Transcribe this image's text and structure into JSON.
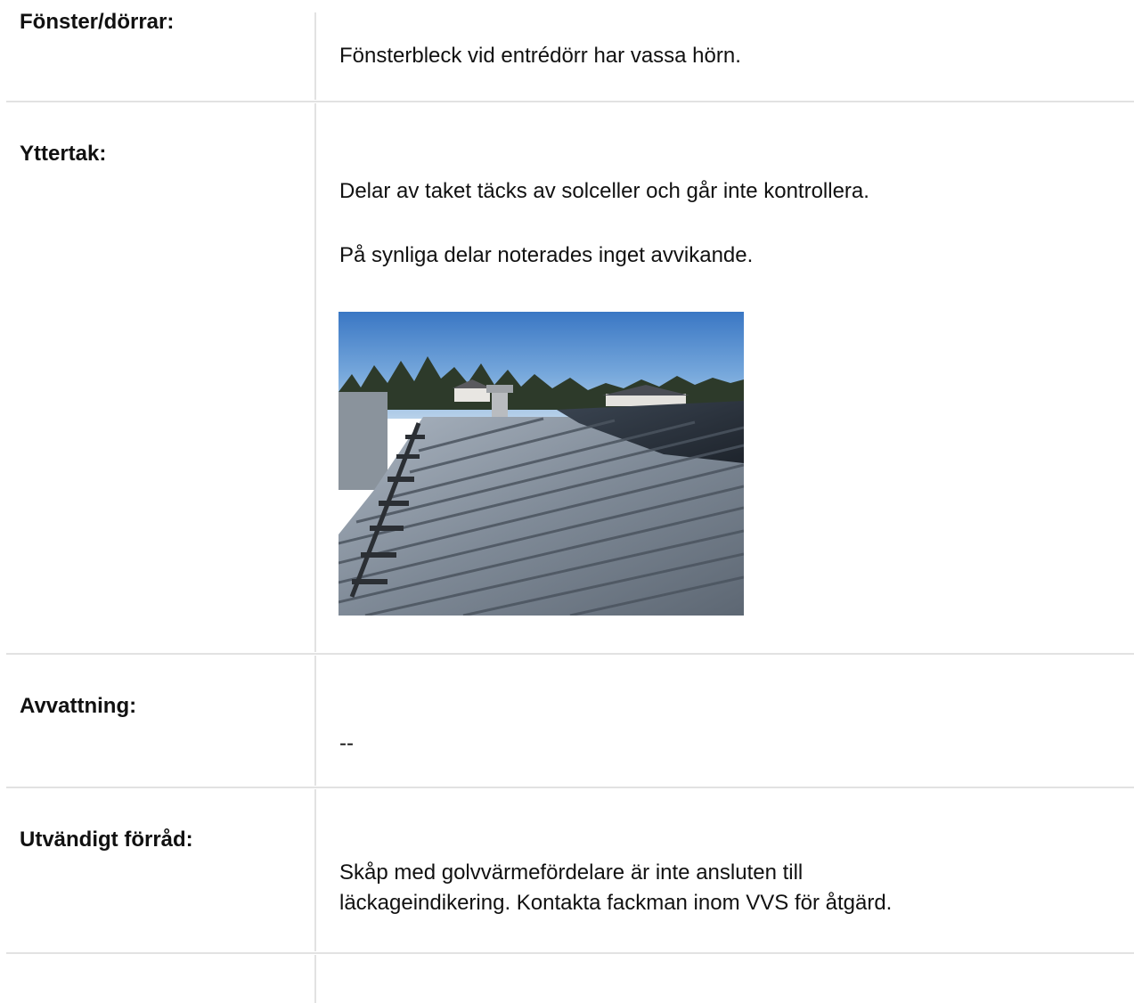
{
  "rows": [
    {
      "label": "Fönster/dörrar:",
      "text": "Fönsterbleck vid entrédörr har vassa hörn."
    },
    {
      "label": "Yttertak:",
      "text": "Delar av taket täcks av solceller och går inte kontrollera.",
      "text2": "På synliga delar noterades inget avvikande."
    },
    {
      "label": "Avvattning:",
      "text": "--"
    },
    {
      "label": "Utvändigt förråd:",
      "text": "Skåp med golvvärmefördelare är inte ansluten till läckageindikering. Kontakta fackman inom VVS för åtgärd."
    }
  ]
}
